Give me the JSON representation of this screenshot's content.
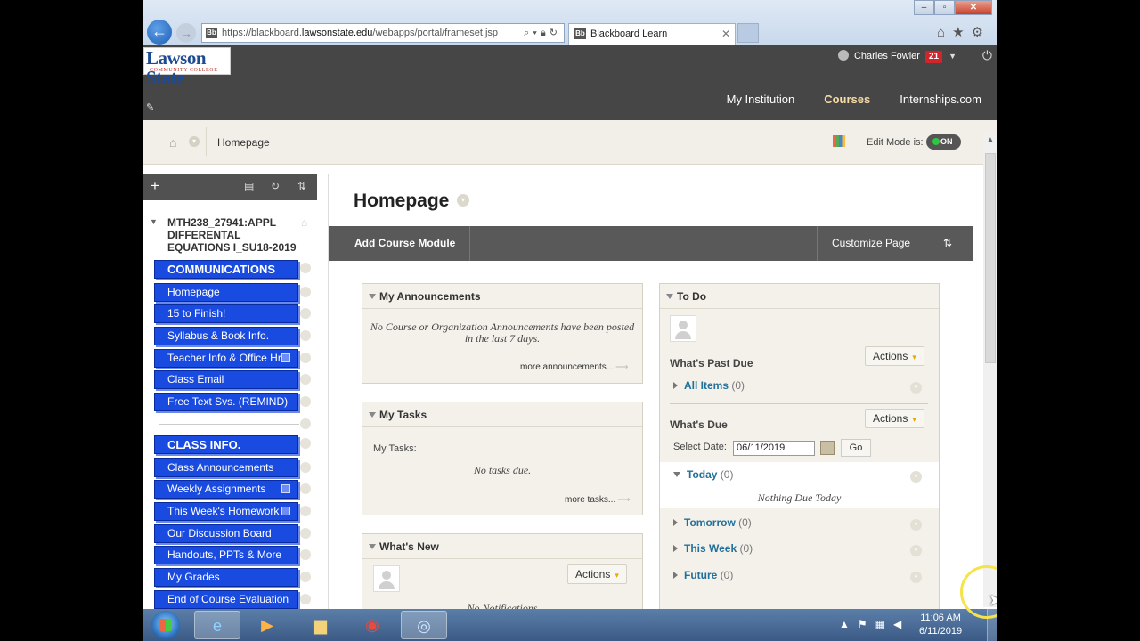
{
  "browser": {
    "url_prefix": "https://blackboard.",
    "url_host": "lawsonstate.edu",
    "url_path": "/webapps/portal/frameset.jsp",
    "tab_title": "Blackboard Learn",
    "favicon_text": "Bb"
  },
  "header": {
    "logo_main": "Lawson State",
    "logo_sub": "COMMUNITY COLLEGE",
    "user_name": "Charles Fowler",
    "notifications": "21",
    "nav": [
      "My Institution",
      "Courses",
      "Internships.com"
    ],
    "active_nav": "Courses"
  },
  "breadcrumb": {
    "current": "Homepage",
    "edit_mode_label": "Edit Mode is:",
    "edit_mode_value": "ON"
  },
  "sidebar": {
    "course_title": "MTH238_27941:APPL DIFFERENTAL EQUATIONS I_SU18-2019",
    "items": [
      {
        "label": "COMMUNICATIONS",
        "heading": true
      },
      {
        "label": "Homepage"
      },
      {
        "label": "15 to Finish!"
      },
      {
        "label": "Syllabus & Book Info."
      },
      {
        "label": "Teacher Info & Office Hrs"
      },
      {
        "label": "Class Email"
      },
      {
        "label": "Free Text Svs. (REMIND)"
      },
      {
        "label": "CLASS INFO.",
        "heading": true
      },
      {
        "label": "Class Announcements"
      },
      {
        "label": "Weekly Assignments"
      },
      {
        "label": "This Week's Homework"
      },
      {
        "label": "Our Discussion Board"
      },
      {
        "label": "Handouts, PPTs & More"
      },
      {
        "label": "My Grades"
      },
      {
        "label": "End of Course Evaluation"
      }
    ]
  },
  "main": {
    "title": "Homepage",
    "add_module": "Add Course Module",
    "customize": "Customize Page",
    "announcements": {
      "title": "My Announcements",
      "empty": "No Course or Organization Announcements have been posted in the last 7 days.",
      "more": "more announcements..."
    },
    "tasks": {
      "title": "My Tasks",
      "label": "My Tasks:",
      "empty": "No tasks due.",
      "more": "more tasks..."
    },
    "whats_new": {
      "title": "What's New",
      "actions": "Actions",
      "empty": "No Notifications"
    },
    "todo": {
      "title": "To Do",
      "past_due": "What's Past Due",
      "actions": "Actions",
      "all_items": "All Items",
      "all_items_count": "(0)",
      "whats_due": "What's Due",
      "select_date": "Select Date:",
      "date": "06/11/2019",
      "go": "Go",
      "today": "Today",
      "today_count": "(0)",
      "nothing_due": "Nothing Due Today",
      "tomorrow": "Tomorrow",
      "tomorrow_count": "(0)",
      "this_week": "This Week",
      "this_week_count": "(0)",
      "future": "Future",
      "future_count": "(0)"
    }
  },
  "taskbar": {
    "time": "11:06 AM",
    "date": "6/11/2019"
  },
  "colors": {
    "menu_blue": "#1a4be0",
    "header_dark": "#464646",
    "link_blue": "#21709c"
  }
}
